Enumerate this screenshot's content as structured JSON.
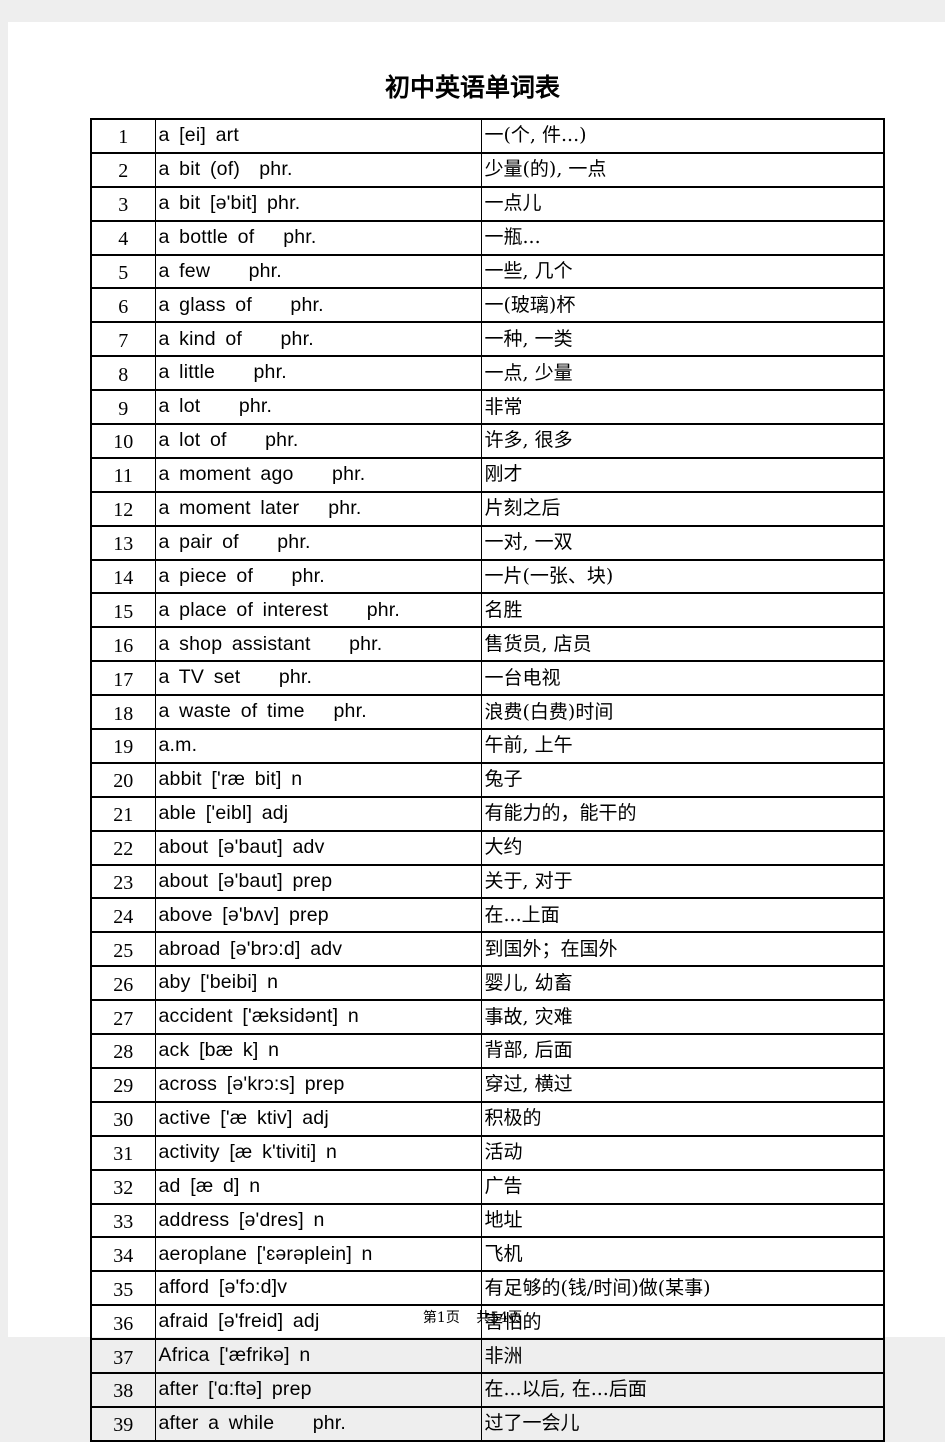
{
  "title": "初中英语单词表",
  "rows": [
    {
      "n": "1",
      "word": "a [ei] art",
      "meaning": "一(个, 件...)"
    },
    {
      "n": "2",
      "word": "a bit (of)  phr.",
      "meaning": "少量(的), 一点"
    },
    {
      "n": "3",
      "word": "a bit [ə'bit] phr.",
      "meaning": "一点儿"
    },
    {
      "n": "4",
      "word": "a bottle of   phr.",
      "meaning": "一瓶..."
    },
    {
      "n": "5",
      "word": "a few    phr.",
      "meaning": "一些, 几个"
    },
    {
      "n": "6",
      "word": "a glass of    phr.",
      "meaning": "一(玻璃)杯"
    },
    {
      "n": "7",
      "word": "a kind of    phr.",
      "meaning": "一种, 一类"
    },
    {
      "n": "8",
      "word": "a little    phr.",
      "meaning": "一点, 少量"
    },
    {
      "n": "9",
      "word": "a lot    phr.",
      "meaning": "非常"
    },
    {
      "n": "10",
      "word": "a lot of    phr.",
      "meaning": "许多, 很多"
    },
    {
      "n": "11",
      "word": "a moment ago    phr.",
      "meaning": "刚才"
    },
    {
      "n": "12",
      "word": "a moment later   phr.",
      "meaning": "片刻之后"
    },
    {
      "n": "13",
      "word": "a pair of    phr.",
      "meaning": "一对, 一双"
    },
    {
      "n": "14",
      "word": "a piece of    phr.",
      "meaning": "一片(一张、块)"
    },
    {
      "n": "15",
      "word": "a place of interest    phr.",
      "meaning": "名胜"
    },
    {
      "n": "16",
      "word": "a shop assistant    phr.",
      "meaning": "售货员, 店员"
    },
    {
      "n": "17",
      "word": "a TV set    phr.",
      "meaning": "一台电视"
    },
    {
      "n": "18",
      "word": "a waste of time   phr.",
      "meaning": "浪费(白费)时间"
    },
    {
      "n": "19",
      "word": "a.m.",
      "meaning": "午前, 上午"
    },
    {
      "n": "20",
      "word": "abbit ['ræ bit] n",
      "meaning": "兔子"
    },
    {
      "n": "21",
      "word": "able ['eibl] adj",
      "meaning": "有能力的，能干的"
    },
    {
      "n": "22",
      "word": "about [ə'baut] adv",
      "meaning": "大约"
    },
    {
      "n": "23",
      "word": "about [ə'baut] prep",
      "meaning": "关于, 对于"
    },
    {
      "n": "24",
      "word": "above [ə'bʌv] prep",
      "meaning": "在...上面"
    },
    {
      "n": "25",
      "word": "abroad [ə'brɔ:d] adv",
      "meaning": "到国外；在国外"
    },
    {
      "n": "26",
      "word": "aby ['beibi] n",
      "meaning": "婴儿, 幼畜"
    },
    {
      "n": "27",
      "word": "accident ['æksidənt] n",
      "meaning": "事故, 灾难"
    },
    {
      "n": "28",
      "word": "ack [bæ k] n",
      "meaning": "背部, 后面"
    },
    {
      "n": "29",
      "word": "across [ə'krɔ:s] prep",
      "meaning": "穿过, 横过"
    },
    {
      "n": "30",
      "word": "active ['æ ktiv] adj",
      "meaning": "积极的"
    },
    {
      "n": "31",
      "word": "activity [æ k'tiviti] n",
      "meaning": "活动"
    },
    {
      "n": "32",
      "word": "ad [æ d] n",
      "meaning": "广告"
    },
    {
      "n": "33",
      "word": "address [ə'dres] n",
      "meaning": "地址"
    },
    {
      "n": "34",
      "word": "aeroplane ['ɛərəplein] n",
      "meaning": "飞机"
    },
    {
      "n": "35",
      "word": "afford [ə'fɔ:d]v",
      "meaning": "有足够的(钱/时间)做(某事)"
    },
    {
      "n": "36",
      "word": "afraid [ə'freid] adj",
      "meaning": "害怕的"
    },
    {
      "n": "37",
      "word": "Africa ['æfrikə] n",
      "meaning": "非洲"
    },
    {
      "n": "38",
      "word": "after ['ɑ:ftə] prep",
      "meaning": "在...以后, 在...后面"
    },
    {
      "n": "39",
      "word": "after a while    phr.",
      "meaning": "过了一会儿"
    }
  ],
  "footer": "第1页 共54页"
}
